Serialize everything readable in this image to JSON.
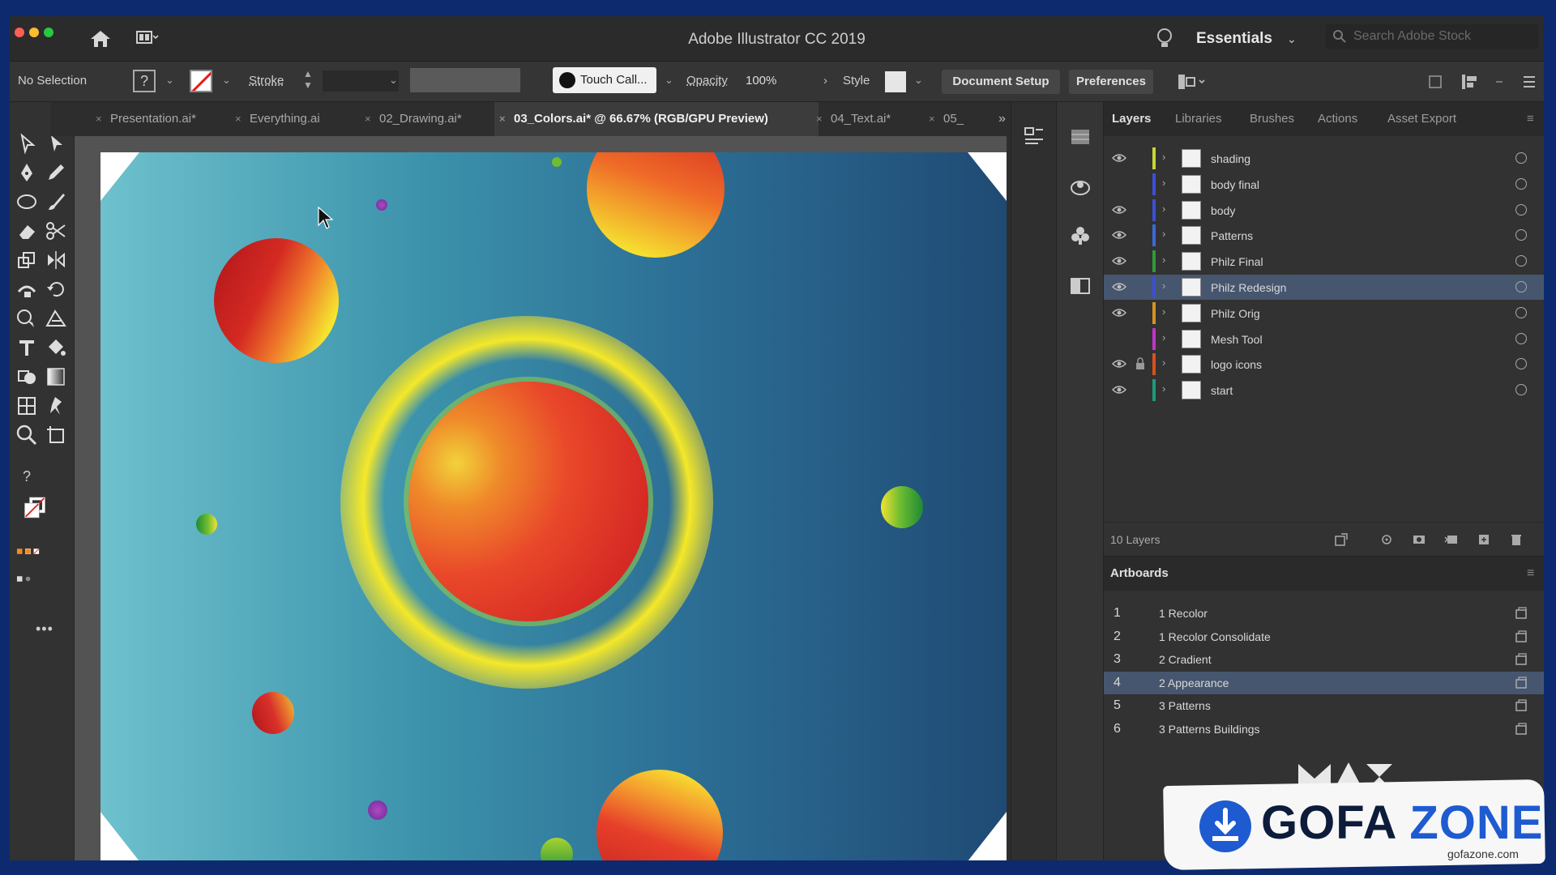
{
  "app": {
    "title": "Adobe Illustrator CC 2019",
    "workspace": "Essentials",
    "stock_search_placeholder": "Search Adobe Stock"
  },
  "control_bar": {
    "selection": "No Selection",
    "fill_unknown": "?",
    "stroke_label": "Stroke",
    "brush": "Touch Call...",
    "opacity_label": "Opacity",
    "opacity_value": "100%",
    "style_label": "Style",
    "document_setup": "Document Setup",
    "preferences": "Preferences"
  },
  "tabs": [
    {
      "label": "Presentation.ai*",
      "active": false
    },
    {
      "label": "Everything.ai",
      "active": false
    },
    {
      "label": "02_Drawing.ai*",
      "active": false
    },
    {
      "label": "03_Colors.ai* @ 66.67% (RGB/GPU Preview)",
      "active": true
    },
    {
      "label": "04_Text.ai*",
      "active": false
    },
    {
      "label": "05_",
      "active": false
    }
  ],
  "layers_panel": {
    "tabs": [
      "Layers",
      "Libraries",
      "Brushes",
      "Actions",
      "Asset Export"
    ],
    "layers": [
      {
        "name": "shading",
        "color": "#c9d631",
        "visible": true,
        "locked": false
      },
      {
        "name": "body final",
        "color": "#3b4fd6",
        "visible": false,
        "locked": false
      },
      {
        "name": "body",
        "color": "#3b4fd6",
        "visible": true,
        "locked": false
      },
      {
        "name": "Patterns",
        "color": "#3a6ad8",
        "visible": true,
        "locked": false
      },
      {
        "name": "Philz Final",
        "color": "#2f9a3a",
        "visible": true,
        "locked": false
      },
      {
        "name": "Philz Redesign",
        "color": "#3b4fd6",
        "visible": true,
        "locked": false,
        "selected": true
      },
      {
        "name": "Philz Orig",
        "color": "#d49320",
        "visible": true,
        "locked": false
      },
      {
        "name": "Mesh Tool",
        "color": "#c233c8",
        "visible": false,
        "locked": false
      },
      {
        "name": "logo icons",
        "color": "#d8501e",
        "visible": true,
        "locked": true
      },
      {
        "name": "start",
        "color": "#1d9a7a",
        "visible": true,
        "locked": false
      }
    ],
    "count": "10 Layers"
  },
  "artboards_panel": {
    "title": "Artboards",
    "items": [
      {
        "num": "1",
        "name": "1 Recolor"
      },
      {
        "num": "2",
        "name": "1 Recolor Consolidate"
      },
      {
        "num": "3",
        "name": "2 Cradient"
      },
      {
        "num": "4",
        "name": "2 Appearance",
        "selected": true
      },
      {
        "num": "5",
        "name": "3 Patterns"
      },
      {
        "num": "6",
        "name": "3 Patterns Buildings"
      }
    ]
  },
  "watermark": {
    "brand_a": "GOFA",
    "brand_b": "ZONE",
    "url": "gofazone.com"
  },
  "colors": {
    "accent_selection": "#46566e",
    "sky_light": "#6ec1cd",
    "sky_dark": "#1f4a74",
    "sun_core": "#e8401e",
    "sun_glow": "#f4e52a",
    "watermark_blue": "#1e5bd0"
  }
}
